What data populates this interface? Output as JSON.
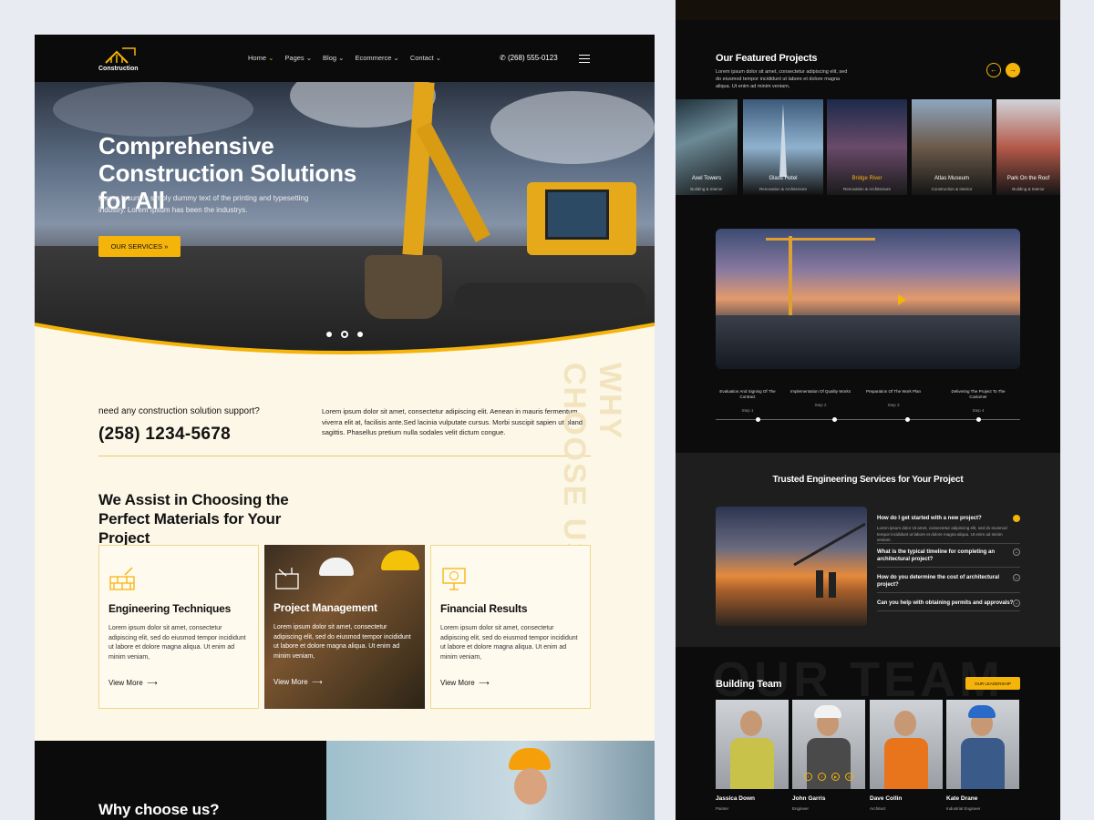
{
  "left": {
    "logo_text": "Construction",
    "menu": [
      {
        "label": "Home",
        "active": true
      },
      {
        "label": "Pages",
        "active": false
      },
      {
        "label": "Blog",
        "active": false
      },
      {
        "label": "Ecommerce",
        "active": false
      },
      {
        "label": "Contact",
        "active": false
      }
    ],
    "phone": "(268) 555-0123",
    "hero": {
      "title": "Comprehensive Construction Solutions for All",
      "text": "Lorem Ipsum is simply dummy text of the printing and typesetting industry. Lorem Ipsum has been the industrys.",
      "button": "OUR SERVICES",
      "active_slide": 2,
      "slide_count": 3
    },
    "support": {
      "label": "need any construction solution support?",
      "phone": "(258) 1234-5678",
      "text": "Lorem ipsum dolor sit amet, consectetur adipiscing elit. Aenean in mauris fermentum, viverra elit at, facilisis ante.Sed lacinia vulputate cursus. Morbi suscipit sapien ut blandit sagittis. Phasellus pretium nulla sodales velit dictum congue."
    },
    "why_vertical": "WHY CHOOSE US",
    "assist_title": "We Assist in Choosing the Perfect Materials for Your Project",
    "cards": [
      {
        "title": "Engineering Techniques",
        "text": "Lorem ipsum dolor sit amet, consectetur adipiscing elit, sed do eiusmod tempor incididunt ut labore et dolore magna aliqua. Ut enim ad minim veniam,",
        "link": "View More"
      },
      {
        "title": "Project Management",
        "text": "Lorem ipsum dolor sit amet, consectetur adipiscing elit, sed do eiusmod tempor incididunt ut labore et dolore magna aliqua. Ut enim ad minim veniam,",
        "link": "View More"
      },
      {
        "title": "Financial Results",
        "text": "Lorem ipsum dolor sit amet, consectetur adipiscing elit, sed do eiusmod tempor incididunt ut labore et dolore magna aliqua. Ut enim ad minim veniam,",
        "link": "View More"
      }
    ],
    "why_title": "Why choose us?"
  },
  "right": {
    "featured": {
      "title": "Our Featured Projects",
      "text": "Lorem ipsum dolor sit amet, consectetur adipiscing elit, sed do eiusmod tempor incididunt ut labore et dolore magna aliqua. Ut enim ad minim veniam,",
      "projects": [
        {
          "name": "Axel Towers",
          "category": "Building & Interior"
        },
        {
          "name": "Glass Hotel",
          "category": "Renovation & Architecture"
        },
        {
          "name": "Bridge River",
          "category": "Renovation & Architecture"
        },
        {
          "name": "Atlas Museum",
          "category": "Construction & Interior"
        },
        {
          "name": "Park On the Roof",
          "category": "Building & Interior"
        }
      ]
    },
    "steps": [
      {
        "title": "Evaluation And Signing Of The Contract",
        "step": "Step 1"
      },
      {
        "title": "Implementation Of Quality Works",
        "step": "Step 2"
      },
      {
        "title": "Preparation Of The Work Plan",
        "step": "Step 3"
      },
      {
        "title": "Delivering The Project To The Customer",
        "step": "Step 4"
      }
    ],
    "faq": {
      "title": "Trusted Engineering Services for Your Project",
      "items": [
        {
          "q": "How do I get started with a new project?",
          "open": true
        },
        {
          "q": "What is the typical timeline for completing an architectural project?",
          "open": false
        },
        {
          "q": "How do you determine the cost of architectural project?",
          "open": false
        },
        {
          "q": "Can you help with obtaining permits and approvals?",
          "open": false
        }
      ],
      "answer": "Lorem ipsum dolor sit amet, consectetur adipiscing elit, sed do eiusmod tempor incididunt ut labore et dolore magna aliqua. Ut enim ad minim veniam."
    },
    "team": {
      "bg_text": "OUR TEAM",
      "title": "Building Team",
      "button": "OUR LEADERSHIP",
      "members": [
        {
          "name": "Jassica Down",
          "role": "Painter"
        },
        {
          "name": "John Garris",
          "role": "Engineer"
        },
        {
          "name": "Dave Collin",
          "role": "Architect"
        },
        {
          "name": "Kate Drane",
          "role": "Industrial Engineer"
        }
      ]
    }
  },
  "colors": {
    "accent": "#f5b40a",
    "dark": "#0b0b0b",
    "cream": "#fdf7e8"
  }
}
